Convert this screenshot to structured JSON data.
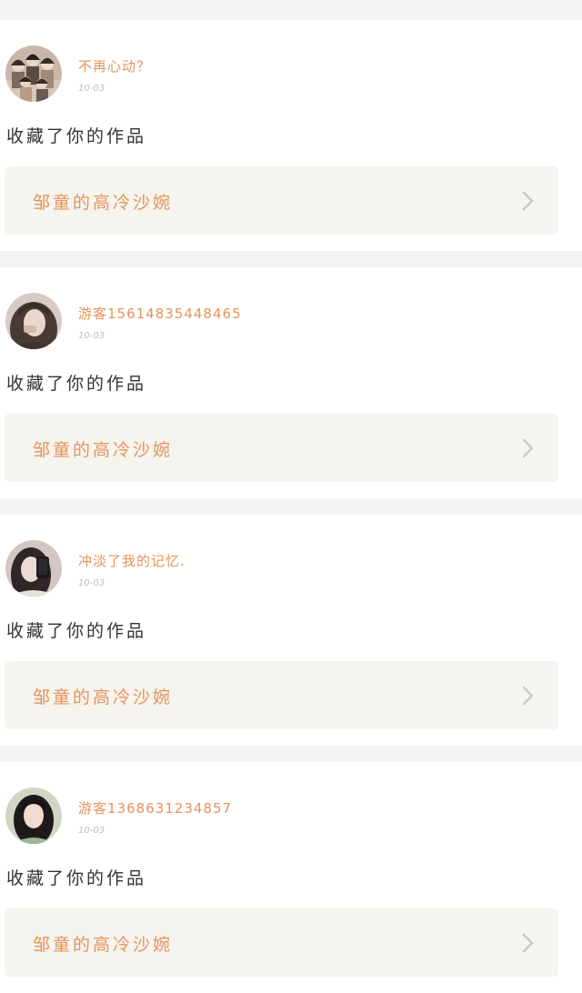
{
  "feed": {
    "items": [
      {
        "username": "不再心动？",
        "date": "10-03",
        "action": "收藏了你的作品",
        "work_title": "邹童的高冷沙婉",
        "avatar_icon": "group-photo-avatar",
        "avatar_colors": [
          "#c9b8a9",
          "#3b2e2a",
          "#e7d6c8"
        ]
      },
      {
        "username": "游客15614835448465",
        "date": "10-03",
        "action": "收藏了你的作品",
        "work_title": "邹童的高冷沙婉",
        "avatar_icon": "portrait-avatar",
        "avatar_colors": [
          "#d9cbc3",
          "#4a3a36",
          "#e9d7cc"
        ]
      },
      {
        "username": "冲淡了我的记忆.",
        "date": "10-03",
        "action": "收藏了你的作品",
        "work_title": "邹童的高冷沙婉",
        "avatar_icon": "portrait-avatar",
        "avatar_colors": [
          "#d4c6c2",
          "#2f2628",
          "#eadbd3"
        ]
      },
      {
        "username": "游客1368631234857",
        "date": "10-03",
        "action": "收藏了你的作品",
        "work_title": "邹童的高冷沙婉",
        "avatar_icon": "portrait-avatar",
        "avatar_colors": [
          "#cfd7c4",
          "#1f1a1a",
          "#f0ddd0"
        ]
      }
    ]
  },
  "colors": {
    "accent": "#e8935a",
    "card_link_bg": "#f5f4ef",
    "separator": "#f4f4f4",
    "text_primary": "#333333",
    "text_muted": "#bdbdbd"
  }
}
